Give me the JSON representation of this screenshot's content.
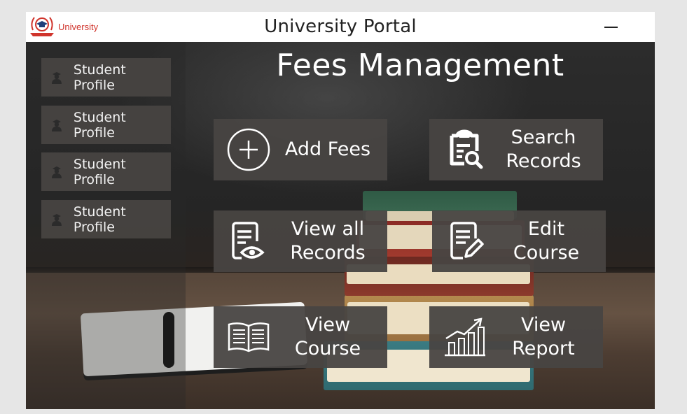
{
  "titlebar": {
    "logo_text": "University",
    "app_title": "University Portal"
  },
  "sidebar": {
    "items": [
      {
        "label": "Student Profile",
        "icon": "student-icon"
      },
      {
        "label": "Student Profile",
        "icon": "student-icon"
      },
      {
        "label": "Student Profile",
        "icon": "student-icon"
      },
      {
        "label": "Student Profile",
        "icon": "student-icon"
      }
    ]
  },
  "main": {
    "heading": "Fees Management",
    "tiles": [
      {
        "label": "Add Fees",
        "icon": "plus-circle-icon"
      },
      {
        "label": "Search Records",
        "icon": "clipboard-search-icon"
      },
      {
        "label": "View all Records",
        "icon": "document-eye-icon"
      },
      {
        "label": "Edit Course",
        "icon": "document-edit-icon"
      },
      {
        "label": "View Course",
        "icon": "open-book-icon"
      },
      {
        "label": "View Report",
        "icon": "bar-chart-growth-icon"
      }
    ]
  },
  "colors": {
    "brand": "#d0342c",
    "tile_background": "#484442",
    "text_light": "#ffffff"
  }
}
